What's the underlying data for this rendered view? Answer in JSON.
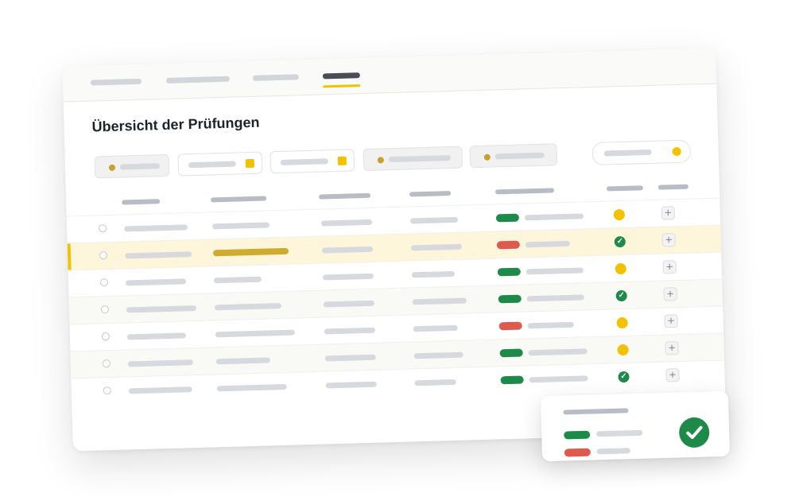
{
  "page": {
    "title": "Übersicht der Prüfungen"
  },
  "tabs": [
    {
      "name": "tab-1",
      "active": false
    },
    {
      "name": "tab-2",
      "active": false
    },
    {
      "name": "tab-3",
      "active": false
    },
    {
      "name": "tab-4",
      "active": true
    }
  ],
  "filters": [
    {
      "style": "filled",
      "marker": "dot"
    },
    {
      "style": "outlined",
      "marker": "square"
    },
    {
      "style": "outlined",
      "marker": "square"
    },
    {
      "style": "filled",
      "marker": "dot"
    },
    {
      "style": "filled",
      "marker": "dot"
    },
    {
      "style": "search",
      "marker": "yellow-dot"
    }
  ],
  "colors": {
    "accent": "#f2c200",
    "success": "#1e8a4a",
    "error": "#de5a4c",
    "highlight": "#cfac2f",
    "placeholder": "#d8d9de"
  },
  "rows": [
    {
      "result": "pass",
      "status": "pending",
      "selected": false
    },
    {
      "result": "fail",
      "status": "done",
      "selected": true
    },
    {
      "result": "pass",
      "status": "pending",
      "selected": false
    },
    {
      "result": "pass",
      "status": "done",
      "selected": false
    },
    {
      "result": "fail",
      "status": "pending",
      "selected": false
    },
    {
      "result": "pass",
      "status": "pending",
      "selected": false
    },
    {
      "result": "pass",
      "status": "done",
      "selected": false
    }
  ],
  "summary_card": {
    "items": [
      "pass",
      "fail"
    ],
    "icon": "check-circle-icon"
  }
}
